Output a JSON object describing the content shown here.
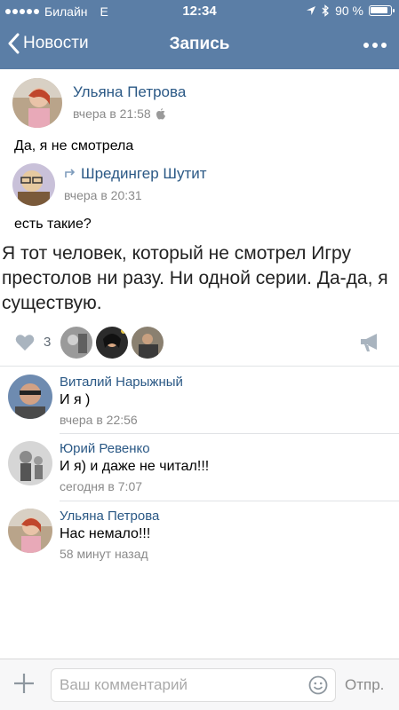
{
  "status_bar": {
    "carrier": "Билайн",
    "network": "E",
    "time": "12:34",
    "battery_percent": "90 %",
    "battery_level": 0.9
  },
  "nav": {
    "back_label": "Новости",
    "title": "Запись"
  },
  "post": {
    "author": "Ульяна Петрова",
    "time": "вчера в 21:58",
    "text": "Да, я не смотрела",
    "repost": {
      "author": "Шредингер Шутит",
      "time": "вчера в 20:31",
      "text": "есть такие?",
      "quote": "Я тот человек, который не смотрел Игру престолов ни разу. Ни одной серии. Да-да, я существую."
    },
    "likes_count": "3"
  },
  "comments": [
    {
      "author": "Виталий Нарыжный",
      "text": "И я )",
      "time": "вчера в 22:56"
    },
    {
      "author": "Юрий Ревенко",
      "text": "И я) и даже не читал!!!",
      "time": "сегодня в 7:07"
    },
    {
      "author": "Ульяна Петрова",
      "text": "Нас немало!!!",
      "time": "58 минут назад"
    }
  ],
  "comment_input": {
    "placeholder": "Ваш комментарий",
    "value": "",
    "send_label": "Отпр."
  },
  "colors": {
    "header": "#5b7ea6",
    "link": "#2a5885",
    "meta": "#8a8a8a"
  }
}
